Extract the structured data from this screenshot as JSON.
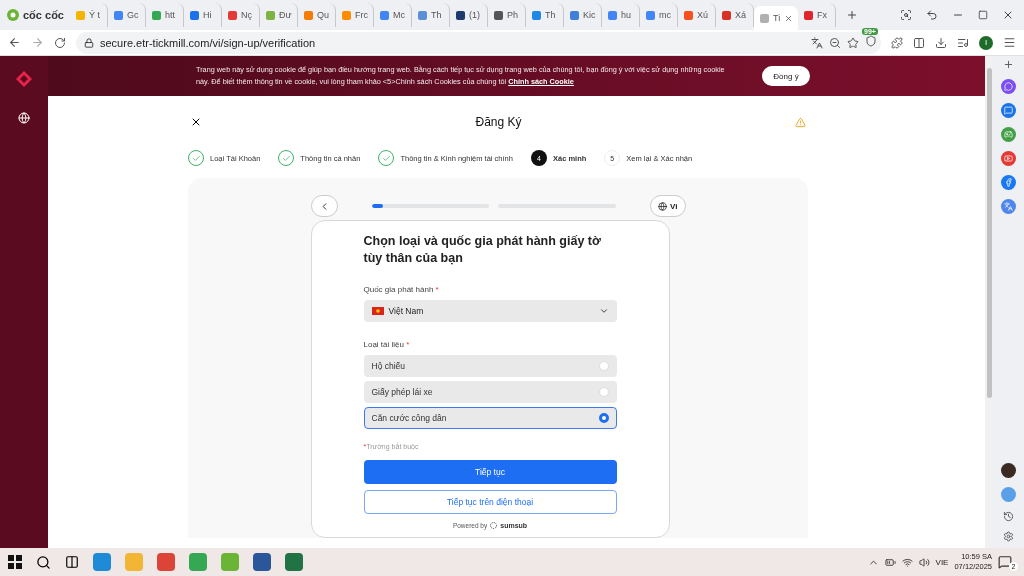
{
  "browser": {
    "brand": "cốc cốc",
    "tabs": [
      {
        "label": "Ý t",
        "color": "#f4b400",
        "selected": false
      },
      {
        "label": "Gc",
        "color": "#4285f4",
        "selected": false
      },
      {
        "label": "htt",
        "color": "#34a853",
        "selected": false
      },
      {
        "label": "Hi",
        "color": "#1a73e8",
        "selected": false
      },
      {
        "label": "Nç",
        "color": "#e53935",
        "selected": false
      },
      {
        "label": "Đư",
        "color": "#7cb342",
        "selected": false
      },
      {
        "label": "Qu",
        "color": "#f57c00",
        "selected": false
      },
      {
        "label": "Frc",
        "color": "#fb8c00",
        "selected": false
      },
      {
        "label": "Mc",
        "color": "#4285f4",
        "selected": false
      },
      {
        "label": "Th",
        "color": "#5c8fd6",
        "selected": false
      },
      {
        "label": "(1)",
        "color": "#1f3a6e",
        "selected": false
      },
      {
        "label": "Ph",
        "color": "#555555",
        "selected": false
      },
      {
        "label": "Th",
        "color": "#1e88e5",
        "selected": false
      },
      {
        "label": "Kic",
        "color": "#3f7fd9",
        "selected": false
      },
      {
        "label": "hu",
        "color": "#4285f4",
        "selected": false
      },
      {
        "label": "mc",
        "color": "#4285f4",
        "selected": false
      },
      {
        "label": "Xú",
        "color": "#f4511e",
        "selected": false
      },
      {
        "label": "Xá",
        "color": "#d93025",
        "selected": false
      },
      {
        "label": "Ti",
        "color": "#b0b0b0",
        "selected": true
      },
      {
        "label": "Fx",
        "color": "#e0242b",
        "selected": false
      }
    ],
    "url": "secure.etr-tickmill.com/vi/sign-up/verification",
    "extensions_badge": "99+",
    "profile_initial": "I"
  },
  "cookie_banner": {
    "text": "Trang web này sử dụng cookie để giúp bạn điều hướng trang web. Bằng cách tiếp tục sử dụng trang web của chúng tôi, bạn đồng ý với việc sử dụng những cookie này. Để biết thêm thông tin về cookie, vui lòng tham khảo <5>Chính sách Cookies của chúng tôi",
    "link": "Chính sách Cookie",
    "button": "Đồng ý"
  },
  "header": {
    "title": "Đăng Ký"
  },
  "steps": [
    {
      "label": "Loại Tài Khoản",
      "kind": "done"
    },
    {
      "label": "Thông tin cá nhân",
      "kind": "done"
    },
    {
      "label": "Thông tin & Kinh nghiệm tài chính",
      "kind": "done"
    },
    {
      "number": "4",
      "label": "Xác minh",
      "kind": "current"
    },
    {
      "number": "5",
      "label": "Xem lại & Xác nhận",
      "kind": "todo"
    }
  ],
  "verification": {
    "progress": {
      "level": 0.1
    },
    "language": "Vi",
    "title": "Chọn loại và quốc gia phát hành giấy tờ tùy thân của bạn",
    "country_label": {
      "text": "Quốc gia phát hành",
      "mark": "*"
    },
    "country": "Việt Nam",
    "document_label": {
      "text": "Loại tài liệu",
      "mark": "*"
    },
    "documents": [
      {
        "label": "Hộ chiếu",
        "selected": false
      },
      {
        "label": "Giấy phép lái xe",
        "selected": false
      },
      {
        "label": "Căn cước công dân",
        "selected": true
      }
    ],
    "required_note": {
      "mark": "*",
      "text": "Trường bắt buộc"
    },
    "primary_button": "Tiếp tục",
    "secondary_button": "Tiếp tục trên điện thoại",
    "powered_by": "Powered by",
    "brand": "sumsub"
  },
  "taskbar": {
    "language": "VIE",
    "time": "10:59 SA",
    "date": "07/12/2025",
    "notifications": "2"
  }
}
